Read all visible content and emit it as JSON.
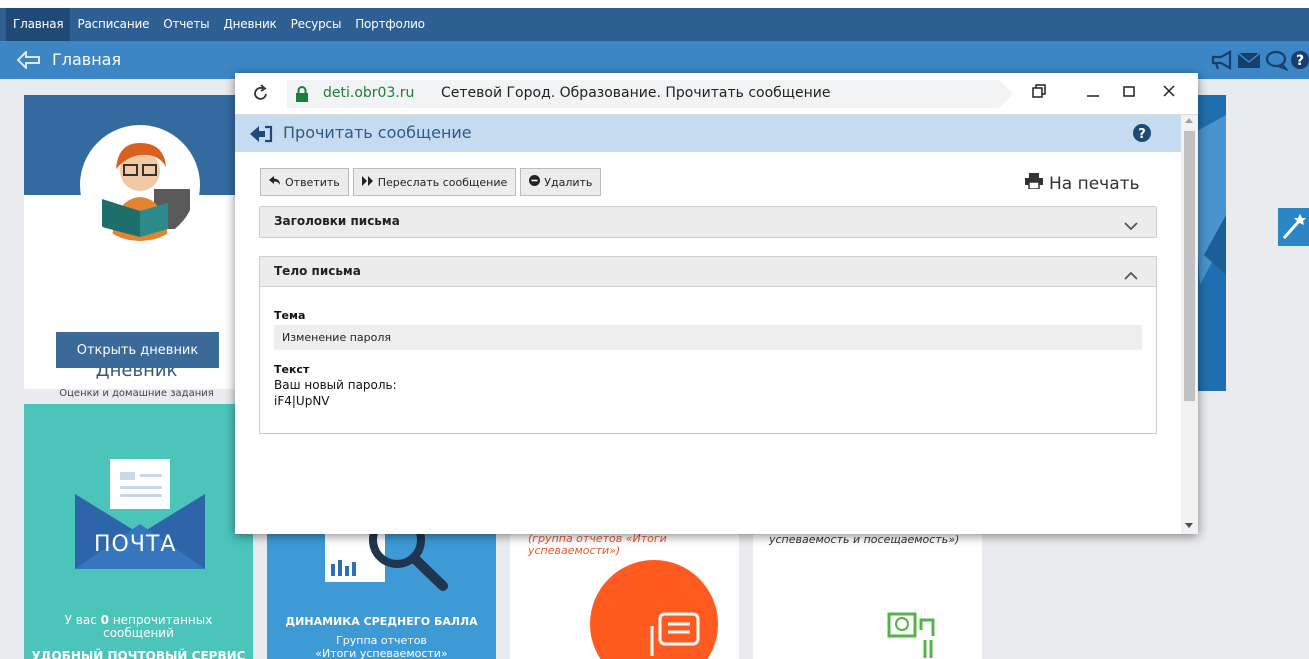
{
  "nav": {
    "items": [
      {
        "label": "Главная",
        "active": true
      },
      {
        "label": "Расписание"
      },
      {
        "label": "Отчеты"
      },
      {
        "label": "Дневник"
      },
      {
        "label": "Ресурсы"
      },
      {
        "label": "Портфолио"
      }
    ]
  },
  "header": {
    "title": "Главная",
    "icons": [
      "megaphone-icon",
      "mail-icon",
      "chat-icon",
      "help-icon"
    ]
  },
  "diary_card": {
    "title": "Дневник",
    "subtitle": "Оценки и домашние задания",
    "button": "Открыть дневник"
  },
  "mail_card": {
    "word": "ПОЧТА",
    "unread_prefix": "У вас",
    "unread_count": "0",
    "unread_suffix": "непрочитанных",
    "unread_line2": "сообщений",
    "service": "УДОБНЫЙ ПОЧТОВЫЙ СЕРВИС"
  },
  "dynamics_card": {
    "title": "ДИНАМИКА СРЕДНЕГО БАЛЛА",
    "sub1": "Группа отчетов",
    "sub2": "«Итоги успеваемости»"
  },
  "results_card": {
    "line1": "(группа отчетов «Итоги",
    "line2": "успеваемости»)"
  },
  "attend_card": {
    "line1": "успеваемость и посещаемость»)"
  },
  "browser": {
    "domain": "deti.obr03.ru",
    "title": "Сетевой Город. Образование. Прочитать сообщение",
    "colors": {
      "domain": "#188038",
      "accent": "#2e5b87"
    }
  },
  "message": {
    "header_title": "Прочитать сообщение",
    "toolbar": {
      "reply": "Ответить",
      "forward": "Переслать сообщение",
      "delete": "Удалить"
    },
    "print": "На печать",
    "headers_panel": "Заголовки письма",
    "body_panel": "Тело письма",
    "subject_label": "Тема",
    "subject_value": "Изменение пароля",
    "text_label": "Текст",
    "text_line1": "Ваш новый пароль:",
    "text_line2": "iF4|UpNV"
  }
}
